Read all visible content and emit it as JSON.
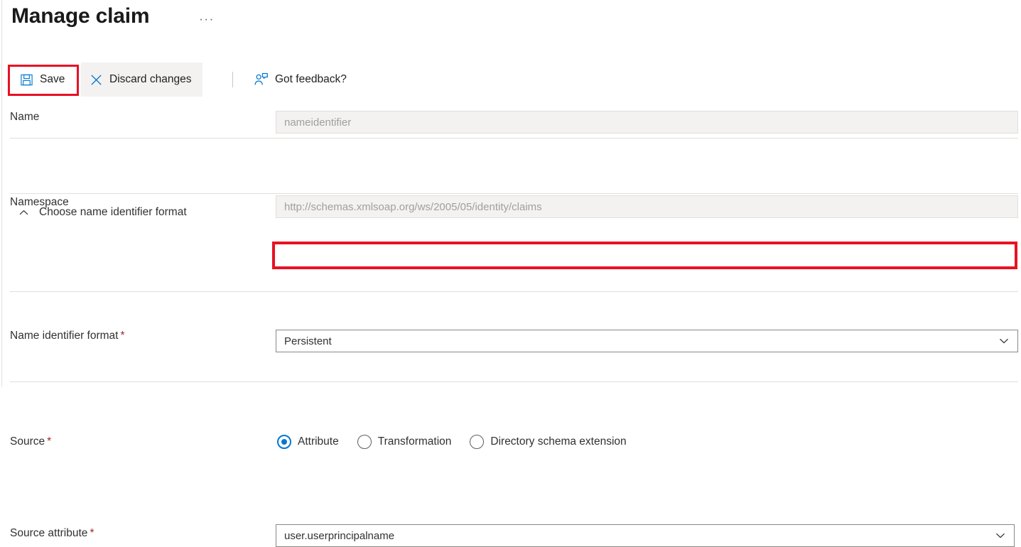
{
  "header": {
    "title": "Manage claim",
    "more_menu": "···"
  },
  "toolbar": {
    "save_label": "Save",
    "discard_label": "Discard changes",
    "feedback_label": "Got feedback?"
  },
  "form": {
    "name": {
      "label": "Name",
      "value": "nameidentifier"
    },
    "namespace": {
      "label": "Namespace",
      "value": "http://schemas.xmlsoap.org/ws/2005/05/identity/claims"
    },
    "accordion": {
      "title": "Choose name identifier format",
      "expanded": true
    },
    "name_identifier_format": {
      "label": "Name identifier format",
      "required": "*",
      "value": "Persistent"
    },
    "source": {
      "label": "Source",
      "required": "*",
      "options": [
        {
          "label": "Attribute",
          "selected": true
        },
        {
          "label": "Transformation",
          "selected": false
        },
        {
          "label": "Directory schema extension",
          "selected": false
        }
      ]
    },
    "source_attribute": {
      "label": "Source attribute",
      "required": "*",
      "value": "user.userprincipalname"
    }
  },
  "colors": {
    "accent": "#0078d4",
    "highlight": "#e81123",
    "required": "#a4262c",
    "disabled_bg": "#f3f2f1",
    "border": "#e1dfdd"
  },
  "icons": {
    "save": "save-floppy-icon",
    "discard": "close-x-icon",
    "feedback": "person-feedback-icon",
    "chevron_up": "chevron-up-icon",
    "chevron_down": "chevron-down-icon"
  }
}
